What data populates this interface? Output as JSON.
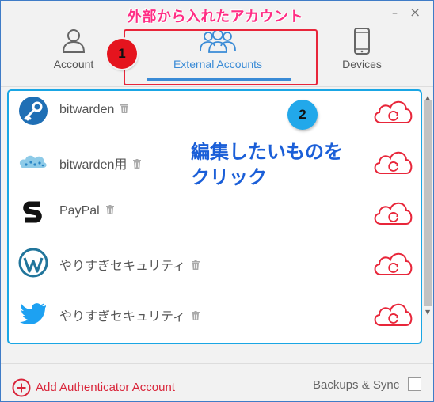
{
  "window": {
    "minimize_icon": "minimize-icon",
    "close_icon": "close-icon",
    "minimize_glyph": "–",
    "close_glyph": "×"
  },
  "annotations": {
    "title": "外部から入れたアカウント",
    "badge_1": "1",
    "badge_2": "2",
    "instruction_line1": "編集したいものを",
    "instruction_line2": "クリック"
  },
  "tabs": [
    {
      "label": "Account",
      "icon": "person-icon",
      "active": false
    },
    {
      "label": "External Accounts",
      "icon": "group-icon",
      "active": true
    },
    {
      "label": "Devices",
      "icon": "phone-icon",
      "active": false
    }
  ],
  "accounts": [
    {
      "name": "bitwarden",
      "icon": "key-icon"
    },
    {
      "name": "bitwarden用",
      "icon": "cloud-dots-icon"
    },
    {
      "name": "PayPal",
      "icon": "s-logo-icon"
    },
    {
      "name": "やりすぎセキュリティ",
      "icon": "wordpress-icon"
    },
    {
      "name": "やりすぎセキュリティ",
      "icon": "twitter-bird-icon"
    }
  ],
  "footer": {
    "add_label": "Add Authenticator Account",
    "backups_label": "Backups & Sync",
    "backups_checked": false
  },
  "colors": {
    "accent_blue": "#3a8bd6",
    "sync_red": "#e8263a",
    "annotation_pink": "#ff2d84",
    "annotation_blue": "#1b5fd8",
    "list_border": "#1aa6e4"
  }
}
